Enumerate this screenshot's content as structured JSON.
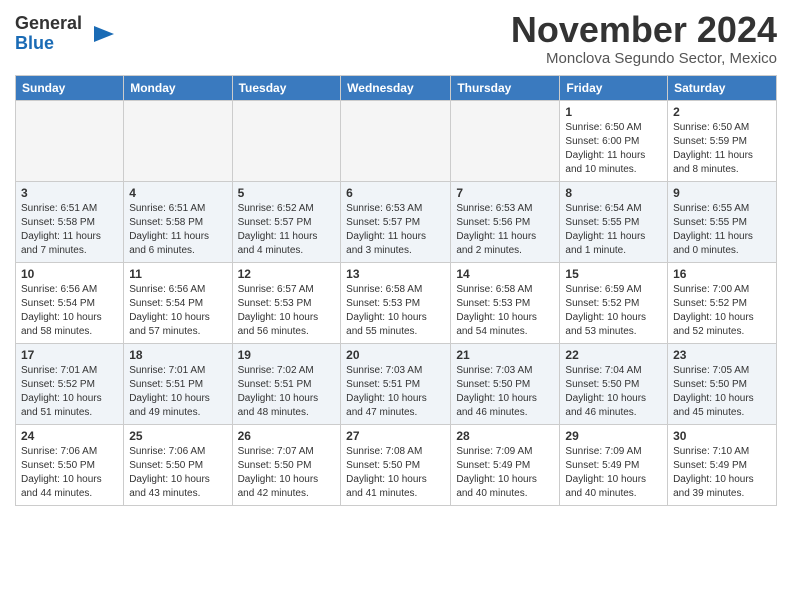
{
  "logo": {
    "general": "General",
    "blue": "Blue"
  },
  "title": "November 2024",
  "location": "Monclova Segundo Sector, Mexico",
  "days_of_week": [
    "Sunday",
    "Monday",
    "Tuesday",
    "Wednesday",
    "Thursday",
    "Friday",
    "Saturday"
  ],
  "weeks": [
    [
      {
        "day": "",
        "empty": true
      },
      {
        "day": "",
        "empty": true
      },
      {
        "day": "",
        "empty": true
      },
      {
        "day": "",
        "empty": true
      },
      {
        "day": "",
        "empty": true
      },
      {
        "day": "1",
        "sunrise": "6:50 AM",
        "sunset": "6:00 PM",
        "daylight": "11 hours and 10 minutes."
      },
      {
        "day": "2",
        "sunrise": "6:50 AM",
        "sunset": "5:59 PM",
        "daylight": "11 hours and 8 minutes."
      }
    ],
    [
      {
        "day": "3",
        "sunrise": "6:51 AM",
        "sunset": "5:58 PM",
        "daylight": "11 hours and 7 minutes."
      },
      {
        "day": "4",
        "sunrise": "6:51 AM",
        "sunset": "5:58 PM",
        "daylight": "11 hours and 6 minutes."
      },
      {
        "day": "5",
        "sunrise": "6:52 AM",
        "sunset": "5:57 PM",
        "daylight": "11 hours and 4 minutes."
      },
      {
        "day": "6",
        "sunrise": "6:53 AM",
        "sunset": "5:57 PM",
        "daylight": "11 hours and 3 minutes."
      },
      {
        "day": "7",
        "sunrise": "6:53 AM",
        "sunset": "5:56 PM",
        "daylight": "11 hours and 2 minutes."
      },
      {
        "day": "8",
        "sunrise": "6:54 AM",
        "sunset": "5:55 PM",
        "daylight": "11 hours and 1 minute."
      },
      {
        "day": "9",
        "sunrise": "6:55 AM",
        "sunset": "5:55 PM",
        "daylight": "11 hours and 0 minutes."
      }
    ],
    [
      {
        "day": "10",
        "sunrise": "6:56 AM",
        "sunset": "5:54 PM",
        "daylight": "10 hours and 58 minutes."
      },
      {
        "day": "11",
        "sunrise": "6:56 AM",
        "sunset": "5:54 PM",
        "daylight": "10 hours and 57 minutes."
      },
      {
        "day": "12",
        "sunrise": "6:57 AM",
        "sunset": "5:53 PM",
        "daylight": "10 hours and 56 minutes."
      },
      {
        "day": "13",
        "sunrise": "6:58 AM",
        "sunset": "5:53 PM",
        "daylight": "10 hours and 55 minutes."
      },
      {
        "day": "14",
        "sunrise": "6:58 AM",
        "sunset": "5:53 PM",
        "daylight": "10 hours and 54 minutes."
      },
      {
        "day": "15",
        "sunrise": "6:59 AM",
        "sunset": "5:52 PM",
        "daylight": "10 hours and 53 minutes."
      },
      {
        "day": "16",
        "sunrise": "7:00 AM",
        "sunset": "5:52 PM",
        "daylight": "10 hours and 52 minutes."
      }
    ],
    [
      {
        "day": "17",
        "sunrise": "7:01 AM",
        "sunset": "5:52 PM",
        "daylight": "10 hours and 51 minutes."
      },
      {
        "day": "18",
        "sunrise": "7:01 AM",
        "sunset": "5:51 PM",
        "daylight": "10 hours and 49 minutes."
      },
      {
        "day": "19",
        "sunrise": "7:02 AM",
        "sunset": "5:51 PM",
        "daylight": "10 hours and 48 minutes."
      },
      {
        "day": "20",
        "sunrise": "7:03 AM",
        "sunset": "5:51 PM",
        "daylight": "10 hours and 47 minutes."
      },
      {
        "day": "21",
        "sunrise": "7:03 AM",
        "sunset": "5:50 PM",
        "daylight": "10 hours and 46 minutes."
      },
      {
        "day": "22",
        "sunrise": "7:04 AM",
        "sunset": "5:50 PM",
        "daylight": "10 hours and 46 minutes."
      },
      {
        "day": "23",
        "sunrise": "7:05 AM",
        "sunset": "5:50 PM",
        "daylight": "10 hours and 45 minutes."
      }
    ],
    [
      {
        "day": "24",
        "sunrise": "7:06 AM",
        "sunset": "5:50 PM",
        "daylight": "10 hours and 44 minutes."
      },
      {
        "day": "25",
        "sunrise": "7:06 AM",
        "sunset": "5:50 PM",
        "daylight": "10 hours and 43 minutes."
      },
      {
        "day": "26",
        "sunrise": "7:07 AM",
        "sunset": "5:50 PM",
        "daylight": "10 hours and 42 minutes."
      },
      {
        "day": "27",
        "sunrise": "7:08 AM",
        "sunset": "5:50 PM",
        "daylight": "10 hours and 41 minutes."
      },
      {
        "day": "28",
        "sunrise": "7:09 AM",
        "sunset": "5:49 PM",
        "daylight": "10 hours and 40 minutes."
      },
      {
        "day": "29",
        "sunrise": "7:09 AM",
        "sunset": "5:49 PM",
        "daylight": "10 hours and 40 minutes."
      },
      {
        "day": "30",
        "sunrise": "7:10 AM",
        "sunset": "5:49 PM",
        "daylight": "10 hours and 39 minutes."
      }
    ]
  ]
}
